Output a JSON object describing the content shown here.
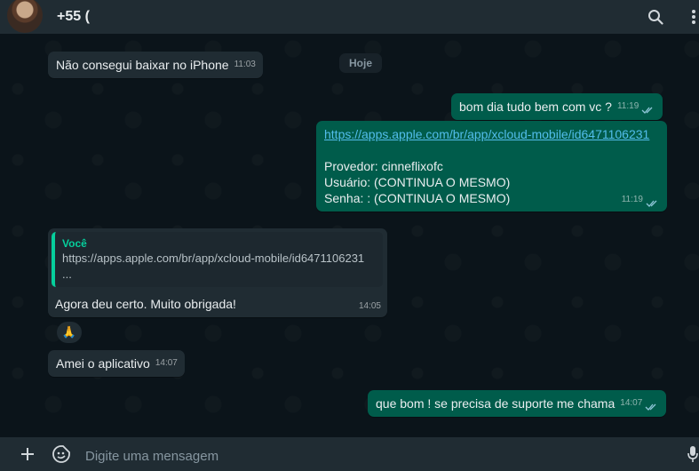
{
  "header": {
    "contact_name": "+55 (",
    "icons": [
      "avatar",
      "search-icon",
      "menu-dots-icon"
    ]
  },
  "chat": {
    "date_divider": "Hoje",
    "messages": [
      {
        "direction": "in",
        "text": "Não consegui baixar no iPhone",
        "time": "11:03"
      },
      {
        "direction": "out",
        "text": "bom dia tudo bem com vc ?",
        "time": "11:19",
        "status": "read"
      },
      {
        "direction": "out",
        "link": "https://apps.apple.com/br/app/xcloud-mobile/id6471106231",
        "lines": [
          "Provedor: cinneflixofc",
          "Usuário: (CONTINUA O MESMO)",
          "Senha: : (CONTINUA O MESMO)"
        ],
        "time": "11:19",
        "status": "read"
      },
      {
        "direction": "in",
        "quote_author": "Você",
        "quote_line1": "https://apps.apple.com/br/app/xcloud-mobile/id6471106231",
        "quote_line2": "...",
        "text": "Agora deu certo. Muito obrigada!",
        "time": "14:05",
        "reaction": "🙏"
      },
      {
        "direction": "in",
        "text": "Amei o aplicativo",
        "time": "14:07"
      },
      {
        "direction": "out",
        "text": "que bom ! se precisa de suporte me chama",
        "time": "14:07",
        "status": "read"
      }
    ]
  },
  "composer": {
    "placeholder": "Digite uma mensagem",
    "icons": [
      "plus-icon",
      "sticker-icon",
      "mic-icon"
    ]
  },
  "colors": {
    "background": "#0b141a",
    "panel": "#202c33",
    "incoming_bubble": "#202c33",
    "outgoing_bubble": "#005c4b",
    "link": "#53bdeb",
    "accent": "#06cf9c"
  }
}
